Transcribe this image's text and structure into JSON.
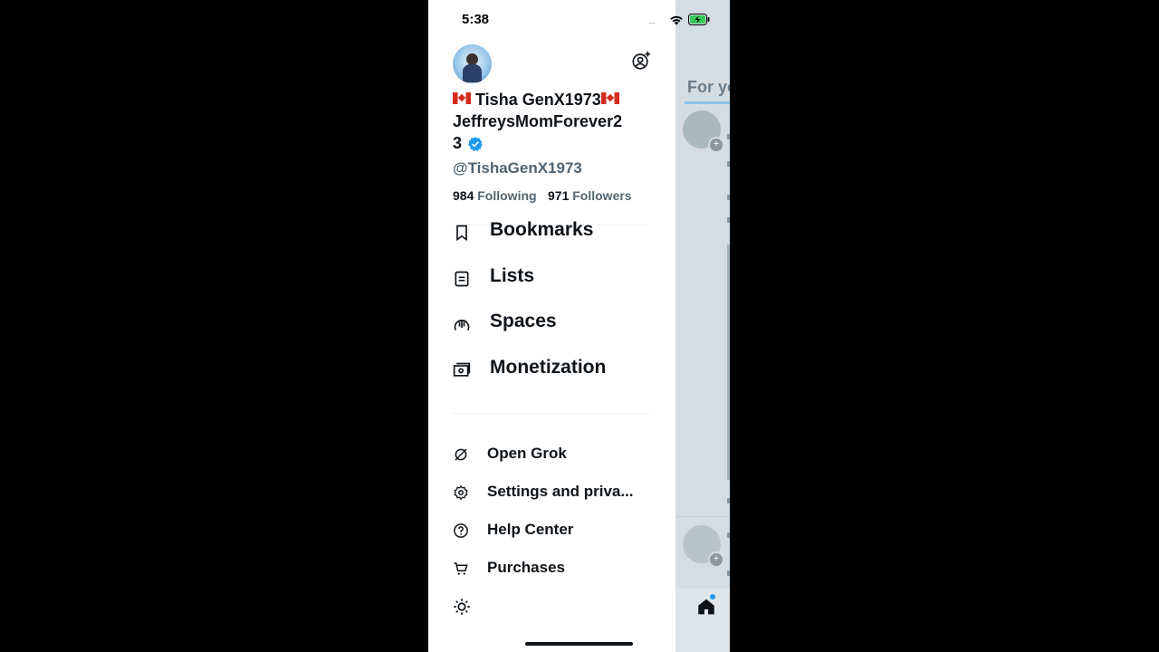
{
  "status_bar": {
    "time": "5:38"
  },
  "profile": {
    "display_name_line1": "Tisha GenX1973",
    "display_name_line2": "JeffreysMomForever2",
    "display_name_line3": "3",
    "handle": "@TishaGenX1973",
    "following_count": "984",
    "following_label": "Following",
    "followers_count": "971",
    "followers_label": "Followers"
  },
  "menu": [
    {
      "label": "Bookmarks",
      "icon": "bookmark-icon"
    },
    {
      "label": "Lists",
      "icon": "lists-icon"
    },
    {
      "label": "Spaces",
      "icon": "spaces-icon"
    },
    {
      "label": "Monetization",
      "icon": "monetization-icon"
    }
  ],
  "secondary_menu": [
    {
      "label": "Open Grok",
      "icon": "grok-icon"
    },
    {
      "label": "Settings and priva...",
      "icon": "gear-icon"
    },
    {
      "label": "Help Center",
      "icon": "help-icon"
    },
    {
      "label": "Purchases",
      "icon": "cart-icon"
    }
  ],
  "background_feed": {
    "tab_label": "For yo"
  },
  "colors": {
    "accent": "#1d9bf0",
    "text": "#0f1419",
    "secondary_text": "#536471"
  }
}
